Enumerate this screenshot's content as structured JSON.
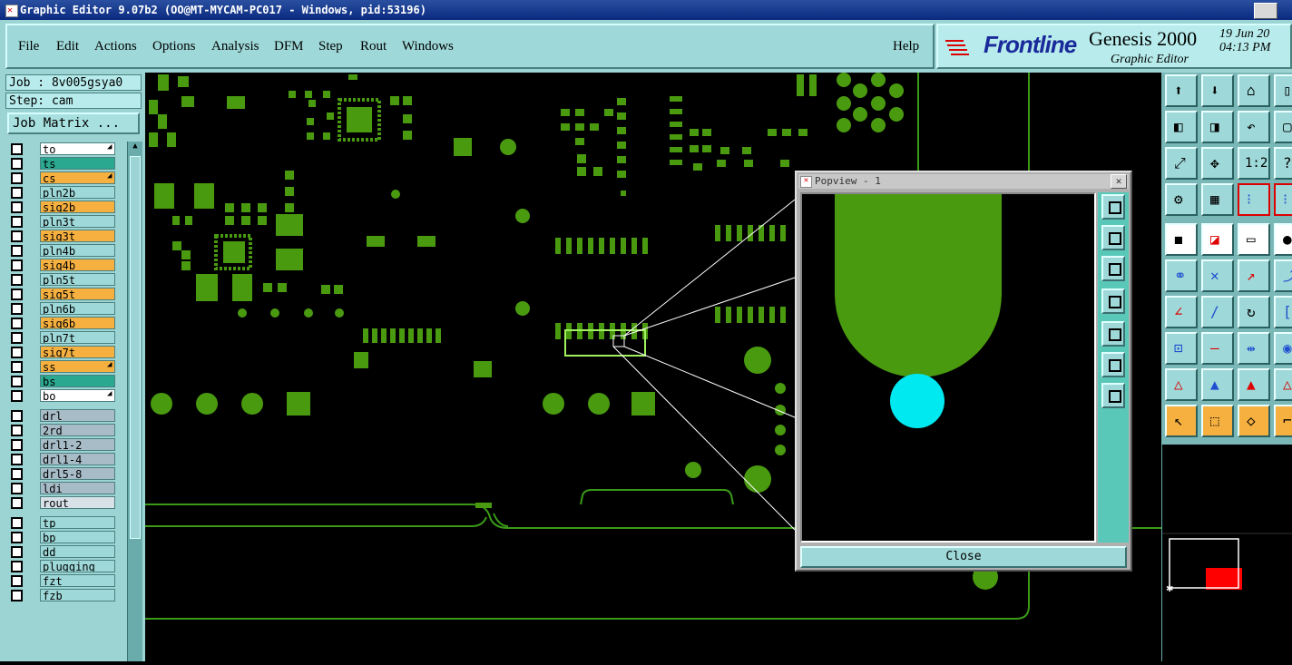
{
  "window": {
    "title": "Graphic Editor 9.07b2 (OO@MT-MYCAM-PC017 - Windows, pid:53196)"
  },
  "menu": {
    "items": [
      "File",
      "Edit",
      "Actions",
      "Options",
      "Analysis",
      "DFM",
      "Step",
      "Rout",
      "Windows"
    ],
    "help": "Help"
  },
  "brand": {
    "company": "Frontline",
    "product": "Genesis 2000",
    "subtitle": "Graphic Editor",
    "date": "19 Jun 20",
    "time": "04:13 PM"
  },
  "job": {
    "job_label": "Job : 8v005gsya0",
    "step_label": "Step: cam",
    "matrix_button": "Job Matrix ..."
  },
  "layers": [
    {
      "name": "to",
      "bg": "#ffffff",
      "mark": true
    },
    {
      "name": "ts",
      "bg": "#2aa890",
      "mark": false
    },
    {
      "name": "cs",
      "bg": "#f6b040",
      "mark": true
    },
    {
      "name": "pln2b",
      "bg": "#9ed8d8",
      "mark": false
    },
    {
      "name": "sig2b",
      "bg": "#f6b040",
      "mark": false
    },
    {
      "name": "pln3t",
      "bg": "#9ed8d8",
      "mark": false
    },
    {
      "name": "sig3t",
      "bg": "#f6b040",
      "mark": false
    },
    {
      "name": "pln4b",
      "bg": "#9ed8d8",
      "mark": false
    },
    {
      "name": "sig4b",
      "bg": "#f6b040",
      "mark": false
    },
    {
      "name": "pln5t",
      "bg": "#9ed8d8",
      "mark": false
    },
    {
      "name": "sig5t",
      "bg": "#f6b040",
      "mark": false
    },
    {
      "name": "pln6b",
      "bg": "#9ed8d8",
      "mark": false
    },
    {
      "name": "sig6b",
      "bg": "#f6b040",
      "mark": false
    },
    {
      "name": "pln7t",
      "bg": "#9ed8d8",
      "mark": false
    },
    {
      "name": "sig7t",
      "bg": "#f6b040",
      "mark": false
    },
    {
      "name": "ss",
      "bg": "#f6b040",
      "mark": true
    },
    {
      "name": "bs",
      "bg": "#2aa890",
      "mark": false
    },
    {
      "name": "bo",
      "bg": "#ffffff",
      "mark": true
    },
    {
      "name": "drl",
      "bg": "#a8bcc8",
      "mark": false
    },
    {
      "name": "2rd",
      "bg": "#a8bcc8",
      "mark": false
    },
    {
      "name": "drl1-2",
      "bg": "#a8bcc8",
      "mark": false
    },
    {
      "name": "drl1-4",
      "bg": "#a8bcc8",
      "mark": false
    },
    {
      "name": "drl5-8",
      "bg": "#a8bcc8",
      "mark": false
    },
    {
      "name": "ldi",
      "bg": "#a8bcc8",
      "mark": false
    },
    {
      "name": "rout",
      "bg": "#d8e0e8",
      "mark": false
    },
    {
      "name": "tp",
      "bg": "#9ed8d8",
      "mark": false
    },
    {
      "name": "bp",
      "bg": "#9ed8d8",
      "mark": false
    },
    {
      "name": "dd",
      "bg": "#9ed8d8",
      "mark": false
    },
    {
      "name": "plugging",
      "bg": "#9ed8d8",
      "mark": false
    },
    {
      "name": "fzt",
      "bg": "#9ed8d8",
      "mark": false
    },
    {
      "name": "fzb",
      "bg": "#9ed8d8",
      "mark": false
    }
  ],
  "popview": {
    "title": "Popview - 1",
    "close_label": "Close"
  },
  "toolbar": {
    "zoom_ratio_label": "1:2"
  },
  "colors": {
    "copper": "#4a9a10",
    "highlight": "#00e8f0",
    "panel": "#9cd4d4"
  }
}
